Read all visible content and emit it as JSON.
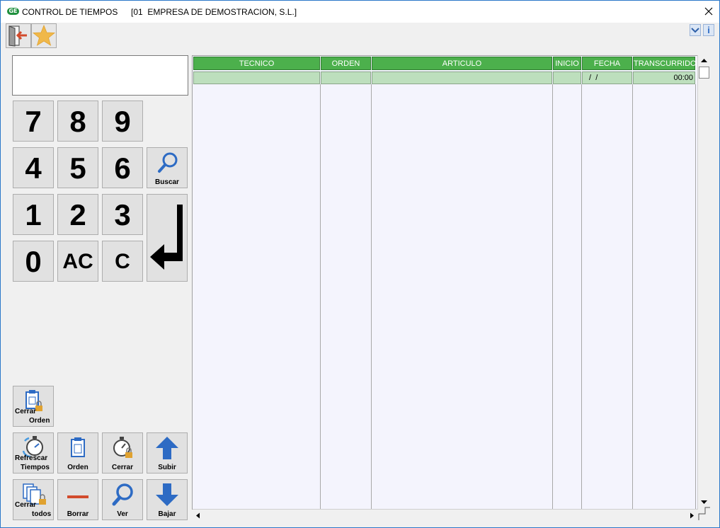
{
  "window": {
    "logo_text": "GE",
    "title": "CONTROL DE TIEMPOS",
    "company": "[01  EMPRESA DE DEMOSTRACION, S.L.]"
  },
  "toolbar": {
    "info_label": "i"
  },
  "display": {
    "value": ""
  },
  "keypad": {
    "k7": "7",
    "k8": "8",
    "k9": "9",
    "k4": "4",
    "k5": "5",
    "k6": "6",
    "k1": "1",
    "k2": "2",
    "k3": "3",
    "k0": "0",
    "kac": "AC",
    "kc": "C",
    "buscar": "Buscar"
  },
  "actions": {
    "cerrar_orden": [
      "Cerrar",
      "Orden"
    ],
    "refrescar": [
      "Refrescar",
      "Tiempos"
    ],
    "orden": "Orden",
    "cerrar": "Cerrar",
    "subir": "Subir",
    "cerrar_todos": [
      "Cerrar",
      "todos"
    ],
    "borrar": "Borrar",
    "ver": "Ver",
    "bajar": "Bajar"
  },
  "grid": {
    "columns": [
      "TECNICO",
      "ORDEN",
      "ARTICULO",
      "INICIO",
      "FECHA",
      "TRANSCURRIDO"
    ],
    "rows": [
      [
        "",
        "",
        "",
        "",
        " /  /",
        "00:00"
      ]
    ]
  },
  "colors": {
    "header_green": "#4cb04c",
    "row_green": "#bddfbd",
    "grid_bg": "#f4f4fd",
    "accent_blue": "#2d6bc4"
  }
}
